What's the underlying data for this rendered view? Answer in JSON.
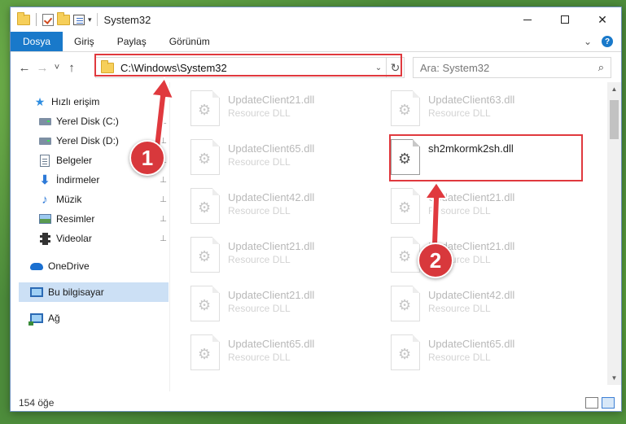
{
  "window": {
    "title": "System32",
    "controls": {
      "minimize": "",
      "maximize": "",
      "close": "✕"
    }
  },
  "ribbon": {
    "tabs": [
      "Dosya",
      "Giriş",
      "Paylaş",
      "Görünüm"
    ],
    "expand": "⌄",
    "help": "?"
  },
  "nav": {
    "back": "←",
    "forward": "→",
    "recent": "˅",
    "up": "↑"
  },
  "address": {
    "path": "C:\\Windows\\System32",
    "dropdown": "⌄",
    "refresh": "↻"
  },
  "search": {
    "placeholder": "Ara: System32",
    "icon": "⌕"
  },
  "sidebar": {
    "items": [
      {
        "label": "Hızlı erişim",
        "icon": "star-icon",
        "pinned": false
      },
      {
        "label": "Yerel Disk (C:)",
        "icon": "drive-icon",
        "pinned": true
      },
      {
        "label": "Yerel Disk (D:)",
        "icon": "drive-icon",
        "pinned": true
      },
      {
        "label": "Belgeler",
        "icon": "documents-icon",
        "pinned": true
      },
      {
        "label": "İndirmeler",
        "icon": "downloads-icon",
        "pinned": true
      },
      {
        "label": "Müzik",
        "icon": "music-icon",
        "pinned": true
      },
      {
        "label": "Resimler",
        "icon": "pictures-icon",
        "pinned": true
      },
      {
        "label": "Videolar",
        "icon": "videos-icon",
        "pinned": true
      },
      {
        "label": "OneDrive",
        "icon": "cloud-icon",
        "pinned": false
      },
      {
        "label": "Bu bilgisayar",
        "icon": "computer-icon",
        "pinned": false,
        "selected": true
      },
      {
        "label": "Ağ",
        "icon": "network-icon",
        "pinned": false
      }
    ],
    "pin_glyph": "📌"
  },
  "files": {
    "left": [
      {
        "name": "UpdateClient21.dll",
        "type": "Resource DLL"
      },
      {
        "name": "UpdateClient65.dll",
        "type": "Resource DLL"
      },
      {
        "name": "UpdateClient42.dll",
        "type": "Resource DLL"
      },
      {
        "name": "UpdateClient21.dll",
        "type": "Resource DLL"
      },
      {
        "name": "UpdateClient21.dll",
        "type": "Resource DLL"
      },
      {
        "name": "UpdateClient65.dll",
        "type": "Resource DLL"
      }
    ],
    "right": [
      {
        "name": "UpdateClient63.dll",
        "type": "Resource DLL"
      },
      {
        "name": "sh2mkormk2sh.dll",
        "type": "",
        "highlighted": true
      },
      {
        "name": "UpdateClient21.dll",
        "type": "Resource DLL"
      },
      {
        "name": "UpdateClient21.dll",
        "type": "Resource DLL"
      },
      {
        "name": "UpdateClient42.dll",
        "type": "Resource DLL"
      },
      {
        "name": "UpdateClient65.dll",
        "type": "Resource DLL"
      }
    ]
  },
  "status": {
    "count": "154 öğe"
  },
  "annotations": {
    "step1": "1",
    "step2": "2"
  },
  "colors": {
    "accent": "#1979ca",
    "highlight_red": "#e0393e",
    "badge_red": "#d8383c",
    "selected_bg": "#cce0f5"
  }
}
